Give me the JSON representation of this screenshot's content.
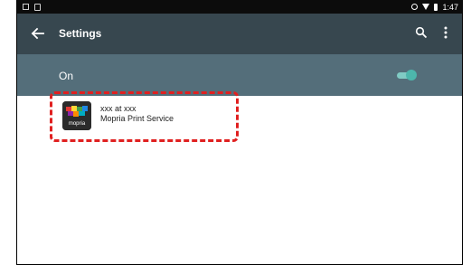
{
  "status_bar": {
    "time": "1:47",
    "left_icons": [
      "notification-icon",
      "image-icon"
    ],
    "right_icons": [
      "sync-icon",
      "wifi-icon",
      "battery-icon"
    ]
  },
  "toolbar": {
    "title": "Settings",
    "back_icon": "arrow-left",
    "actions": [
      "search-icon",
      "more-vert-icon"
    ],
    "color": "#37474f"
  },
  "switch_bar": {
    "label": "On",
    "checked": true,
    "color": "#546e7a",
    "accent": "#4db6ac"
  },
  "printers": [
    {
      "name": "xxx at xxx",
      "service": "Mopria Print Service",
      "icon_label": "mopria",
      "icon": "mopria-icon"
    }
  ],
  "highlight": {
    "color": "#e02020",
    "style": "dashed"
  }
}
